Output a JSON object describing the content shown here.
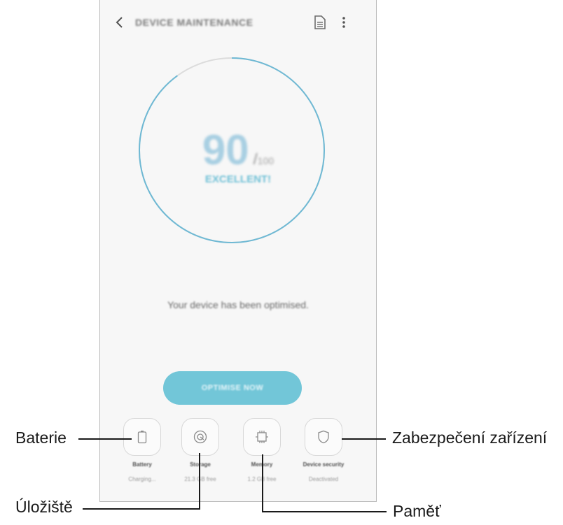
{
  "appbar": {
    "title": "DEVICE MAINTENANCE"
  },
  "score": {
    "value": "90",
    "slash": "/",
    "max": "100",
    "status": "EXCELLENT!",
    "ring_fraction": 0.9
  },
  "message": "Your device has been optimised.",
  "optimise_label": "OPTIMISE NOW",
  "categories": [
    {
      "label": "Battery",
      "sub": "Charging..."
    },
    {
      "label": "Storage",
      "sub": "21.3 GB free"
    },
    {
      "label": "Memory",
      "sub": "1.2 GB free"
    },
    {
      "label": "Device security",
      "sub": "Deactivated"
    }
  ],
  "callouts": {
    "battery": "Baterie",
    "storage": "Úložiště",
    "memory": "Paměť",
    "security": "Zabezpečení zařízení"
  },
  "colors": {
    "accent": "#72c6d8",
    "ring": "#6fb9d4",
    "ring_track": "#dcdcdc"
  }
}
